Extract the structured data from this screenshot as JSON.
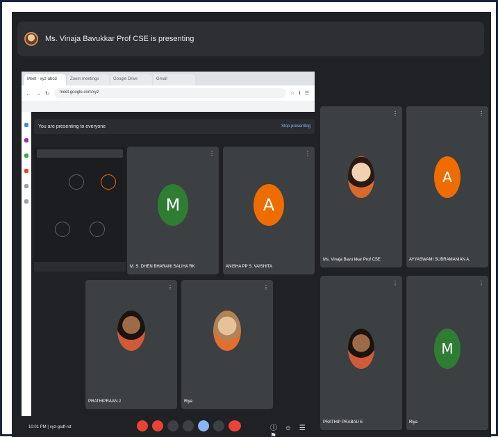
{
  "banner": {
    "text": "Ms. Vinaja Bavukkar Prof CSE is presenting"
  },
  "browser": {
    "tabs": [
      "Meet - xyz-abcd",
      "Zoom meetings",
      "Google Drive",
      "Gmail"
    ],
    "url": "meet.google.com/xyz",
    "extensions": "☆ ℹ ☰"
  },
  "inner_meet": {
    "bar_title": "You are presenting to everyone",
    "stop_label": "Stop presenting",
    "tiles": [
      {
        "name": "M. S. DHEN BHARANI SALIHA RK",
        "initial": "M",
        "color": "#2f7d32"
      },
      {
        "name": "ANISHA PP S. VAISHITA",
        "initial": "A",
        "color": "#ef6c00"
      },
      {
        "name": "PRATHIPRAAN J"
      },
      {
        "name": "Riya"
      }
    ]
  },
  "right_tiles": [
    {
      "name": "Ms. Vinaja Bavu kkar Prof CSE"
    },
    {
      "name": "AYYASWAMI SUBRAMANIAN A.",
      "initial": "A",
      "color": "#ef6c00"
    },
    {
      "name": "PRATHIP PRABAU E"
    },
    {
      "name": "Riya",
      "initial": "M",
      "color": "#2f7d32"
    }
  ],
  "controls": {
    "meeting_info": "10:01 PM | xyz-gsdf-rst",
    "right_icons": "ⓘ ☺ ☰ ⚑"
  },
  "tile_menu": "⋮"
}
